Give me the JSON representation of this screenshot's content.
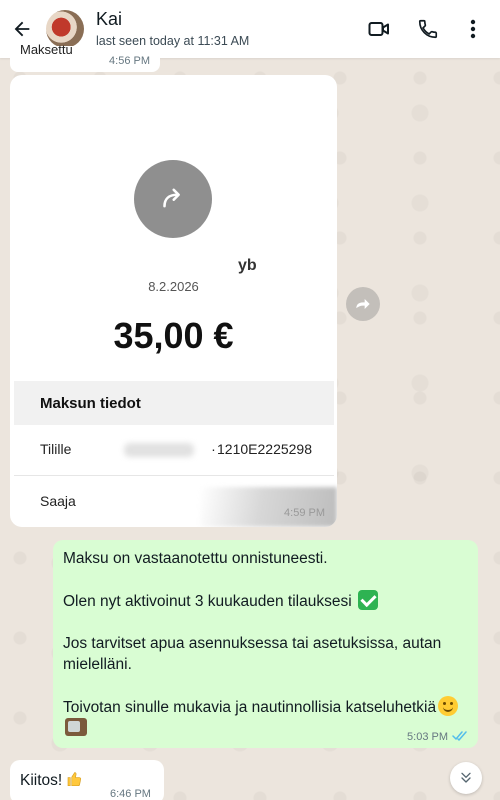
{
  "header": {
    "contact_name": "Kai",
    "status": "last seen today at 11:31 AM"
  },
  "messages": {
    "top_partial": {
      "text": "Maksettu",
      "time": "4:56 PM"
    },
    "payment": {
      "recipient_partial": "yb",
      "date": "8.2.2026",
      "amount": "35,00 €",
      "details_heading": "Maksun tiedot",
      "rows": [
        {
          "label": "Tilille",
          "value": " 1210E2225298"
        },
        {
          "label": "Saaja",
          "value": ""
        }
      ],
      "time": "4:59 PM"
    },
    "outgoing": {
      "paragraphs": [
        "Maksu on vastaanotettu onnistuneesti.",
        "Olen nyt aktivoinut 3 kuukauden tilauksesi",
        "Jos tarvitset apua asennuksessa tai asetuksissa, autan mielelläni.",
        "Toivotan sinulle mukavia ja nautinnollisia katseluhetkiä"
      ],
      "time": "5:03 PM"
    },
    "incoming": {
      "text": "Kiitos!",
      "time": "6:46 PM"
    }
  },
  "icons": {
    "back": "arrow-left-icon",
    "video": "video-camera-icon",
    "call": "phone-icon",
    "menu": "more-vertical-icon",
    "forward": "forward-icon",
    "scroll_down": "double-chevron-down-icon"
  },
  "colors": {
    "outgoing_bubble": "#d9fdd3",
    "incoming_bubble": "#ffffff",
    "read_ticks": "#53bdeb"
  }
}
